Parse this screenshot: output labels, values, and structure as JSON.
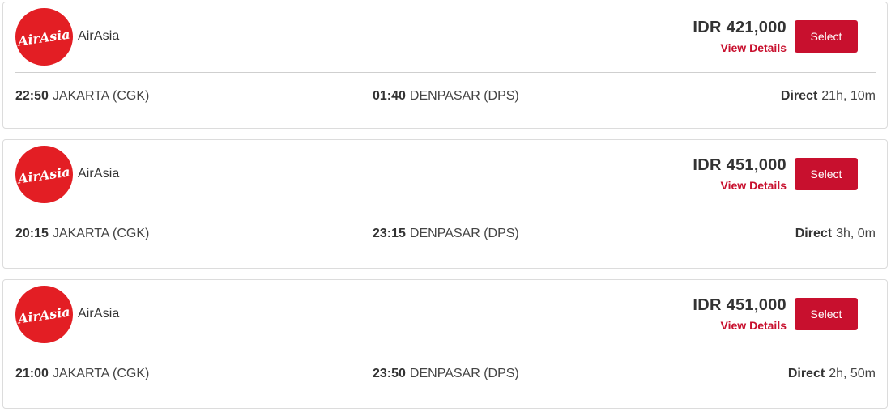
{
  "brand": {
    "accent_color": "#c8102e",
    "logo_color": "#e31e24",
    "logo_text": "AirAsia"
  },
  "flights": [
    {
      "airline": "AirAsia",
      "price": "IDR 421,000",
      "view_details": "View Details",
      "select_label": "Select",
      "departure_time": "22:50",
      "departure_place": "JAKARTA (CGK)",
      "arrival_time": "01:40",
      "arrival_place": "DENPASAR (DPS)",
      "stop_type": "Direct",
      "duration": "21h, 10m"
    },
    {
      "airline": "AirAsia",
      "price": "IDR 451,000",
      "view_details": "View Details",
      "select_label": "Select",
      "departure_time": "20:15",
      "departure_place": "JAKARTA (CGK)",
      "arrival_time": "23:15",
      "arrival_place": "DENPASAR (DPS)",
      "stop_type": "Direct",
      "duration": "3h, 0m"
    },
    {
      "airline": "AirAsia",
      "price": "IDR 451,000",
      "view_details": "View Details",
      "select_label": "Select",
      "departure_time": "21:00",
      "departure_place": "JAKARTA (CGK)",
      "arrival_time": "23:50",
      "arrival_place": "DENPASAR (DPS)",
      "stop_type": "Direct",
      "duration": "2h, 50m"
    }
  ]
}
